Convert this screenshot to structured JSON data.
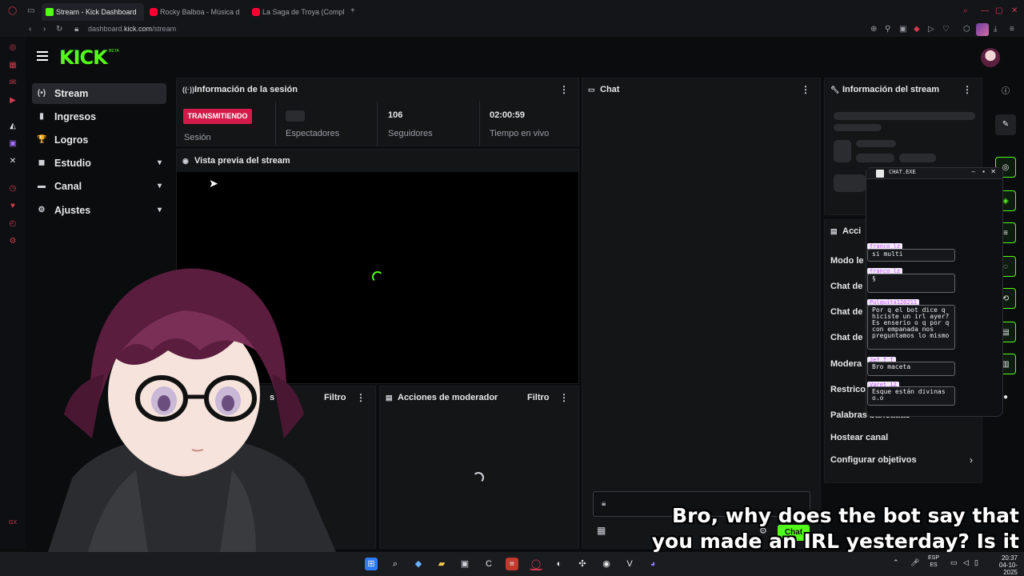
{
  "browser": {
    "tabs": [
      {
        "label": "Stream - Kick Dashboard",
        "favicon_color": "#53fc18"
      },
      {
        "label": "Rocky Balboa - Música d",
        "favicon_color": "#ff0033"
      },
      {
        "label": "La Saga de Troya (Compl",
        "favicon_color": "#ff0033"
      }
    ],
    "new_tab": "+",
    "url_prefix": "dashboard.",
    "url_domain": "kick.com",
    "url_path": "/stream"
  },
  "header": {
    "logo": "KICK",
    "logo_badge": "BETA"
  },
  "nav": [
    {
      "label": "Stream",
      "icon": "stream-icon",
      "glyph": "(•)",
      "active": true,
      "chevron": false
    },
    {
      "label": "Ingresos",
      "icon": "money-icon",
      "glyph": "▮",
      "active": false,
      "chevron": false
    },
    {
      "label": "Logros",
      "icon": "trophy-icon",
      "glyph": "🏆",
      "active": false,
      "chevron": false
    },
    {
      "label": "Estudio",
      "icon": "studio-icon",
      "glyph": "◼",
      "active": false,
      "chevron": true
    },
    {
      "label": "Canal",
      "icon": "channel-icon",
      "glyph": "▬",
      "active": false,
      "chevron": true
    },
    {
      "label": "Ajustes",
      "icon": "settings-icon",
      "glyph": "⚙",
      "active": false,
      "chevron": true
    }
  ],
  "session": {
    "title": "Información de la sesión",
    "status_badge": "TRANSMITIENDO",
    "status_label": "Sesión",
    "viewers_label": "Espectadores",
    "followers_value": "106",
    "followers_label": "Seguidores",
    "uptime_value": "02:00:59",
    "uptime_label": "Tiempo en vivo"
  },
  "preview": {
    "title": "Vista previa del stream"
  },
  "left_bottom_panel": {
    "partial_title": "s",
    "filter_label": "Filtro"
  },
  "mod_actions": {
    "title": "Acciones de moderador",
    "filter_label": "Filtro"
  },
  "chat": {
    "title": "Chat",
    "send_label": "Chat"
  },
  "stream_info": {
    "title": "Información del stream"
  },
  "actions_panel": {
    "title_partial": "Acci",
    "rows": [
      {
        "label": "Modo le"
      },
      {
        "label": "Chat de"
      },
      {
        "label": "Chat de"
      },
      {
        "label": "Chat de"
      },
      {
        "label": "Modera"
      },
      {
        "label": "Restrico"
      },
      {
        "label": "Palabras baneadas"
      },
      {
        "label": "Hostear canal"
      },
      {
        "label": "Configurar objetivos"
      }
    ]
  },
  "chat_exe": {
    "title": "CHAT.EXE",
    "messages": [
      {
        "user": "franco_lz",
        "text": "si multi"
      },
      {
        "user": "franco_lz",
        "text": "§"
      },
      {
        "user": "Pulquita120211",
        "text": "Por q el bot dice q hiciste un irl ayer? Es enserio o q por q con empanada nos preguntamos lo mismo"
      },
      {
        "user": "Jef_T_T",
        "text": "Bro maceta"
      },
      {
        "user": "Varet_12",
        "text": "Esque están divinas o.o"
      }
    ]
  },
  "captions": {
    "line1": "Bro, why does the bot say that",
    "line2": "you made an IRL yesterday? Is it"
  },
  "taskbar": {
    "lang": "ESP",
    "lang_sub": "ES",
    "time": "20:37",
    "date": "04-10-2025"
  },
  "colors": {
    "brand": "#53fc18",
    "live_badge": "#d31b4a",
    "opera_red": "#d23a4f"
  }
}
